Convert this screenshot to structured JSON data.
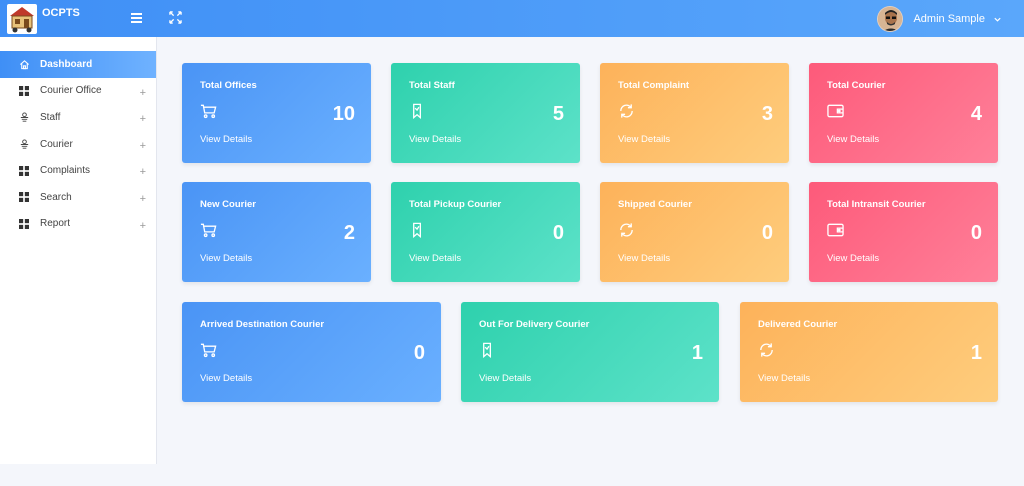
{
  "brand": {
    "name": "OCPTS"
  },
  "user": {
    "name": "Admin Sample"
  },
  "sidebar": {
    "items": [
      {
        "label": "Dashboard",
        "icon": "home-icon",
        "active": true
      },
      {
        "label": "Courier Office",
        "icon": "grid-icon"
      },
      {
        "label": "Staff",
        "icon": "staff-icon"
      },
      {
        "label": "Courier",
        "icon": "staff-icon"
      },
      {
        "label": "Complaints",
        "icon": "grid-icon"
      },
      {
        "label": "Search",
        "icon": "grid-icon"
      },
      {
        "label": "Report",
        "icon": "grid-icon"
      }
    ],
    "expand_symbol": "+"
  },
  "cards": [
    {
      "title": "Total Offices",
      "count": "10",
      "link": "View Details",
      "color": "blue",
      "icon": "cart-icon"
    },
    {
      "title": "Total Staff",
      "count": "5",
      "link": "View Details",
      "color": "green",
      "icon": "bookmark-icon"
    },
    {
      "title": "Total Complaint",
      "count": "3",
      "link": "View Details",
      "color": "orange",
      "icon": "refresh-icon"
    },
    {
      "title": "Total Courier",
      "count": "4",
      "link": "View Details",
      "color": "red",
      "icon": "wallet-icon"
    },
    {
      "title": "New Courier",
      "count": "2",
      "link": "View Details",
      "color": "blue",
      "icon": "cart-icon"
    },
    {
      "title": "Total Pickup Courier",
      "count": "0",
      "link": "View Details",
      "color": "green",
      "icon": "bookmark-icon"
    },
    {
      "title": "Shipped Courier",
      "count": "0",
      "link": "View Details",
      "color": "orange",
      "icon": "refresh-icon"
    },
    {
      "title": "Total Intransit Courier",
      "count": "0",
      "link": "View Details",
      "color": "red",
      "icon": "wallet-icon"
    },
    {
      "title": "Arrived Destination Courier",
      "count": "0",
      "link": "View Details",
      "color": "blue",
      "icon": "cart-icon"
    },
    {
      "title": "Out For Delivery Courier",
      "count": "1",
      "link": "View Details",
      "color": "green",
      "icon": "bookmark-icon"
    },
    {
      "title": "Delivered Courier",
      "count": "1",
      "link": "View Details",
      "color": "orange",
      "icon": "refresh-icon"
    }
  ],
  "colors": {
    "blue": "#4a94f5",
    "green": "#2ed1ad",
    "orange": "#fdb25a",
    "red": "#fd5a7a",
    "topbar": "#3f8ff6"
  }
}
